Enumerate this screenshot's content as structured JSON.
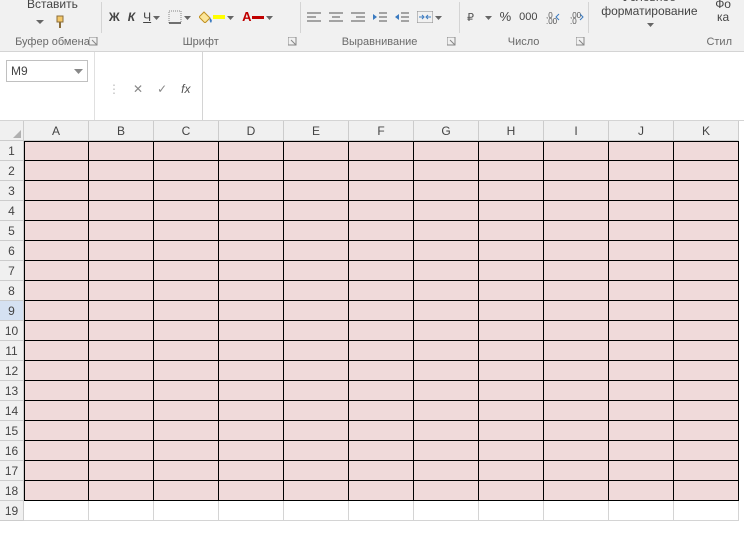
{
  "ribbon": {
    "paste_label": "Вставить",
    "clipboard_group": "Буфер обмена",
    "font_group": "Шрифт",
    "alignment_group": "Выравнивание",
    "number_group": "Число",
    "styles_group": "Стил",
    "bold": "Ж",
    "italic": "К",
    "underline": "Ч",
    "percent": "%",
    "thousands": "000",
    "conditional_line1": "Условное",
    "conditional_line2": "форматирование",
    "format_as_line1": "Фо",
    "format_as_line2": "ка"
  },
  "formula": {
    "cell_ref": "M9",
    "fx": "fx",
    "value": ""
  },
  "sheet": {
    "columns": [
      "A",
      "B",
      "C",
      "D",
      "E",
      "F",
      "G",
      "H",
      "I",
      "J",
      "K"
    ],
    "rows": [
      1,
      2,
      3,
      4,
      5,
      6,
      7,
      8,
      9,
      10,
      11,
      12,
      13,
      14,
      15,
      16,
      17,
      18,
      19
    ],
    "active_row": 9,
    "pink_rows": 18
  }
}
